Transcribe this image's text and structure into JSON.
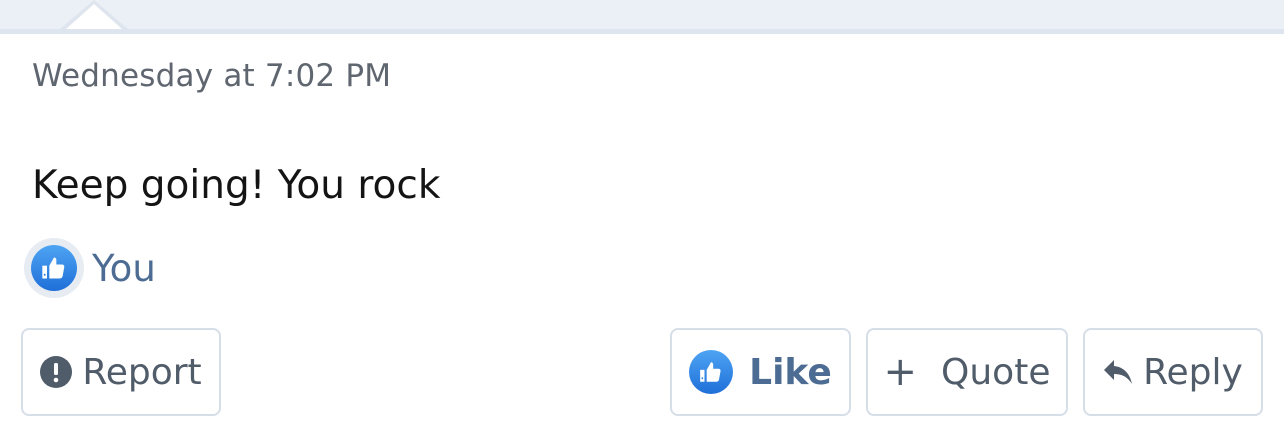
{
  "post": {
    "timestamp": "Wednesday at 7:02 PM",
    "message": "Keep going! You rock"
  },
  "reactions": {
    "icon": "thumbs-up-icon",
    "user": "You"
  },
  "actions": {
    "report_label": "Report",
    "like_label": "Like",
    "quote_label": "Quote",
    "reply_label": "Reply"
  },
  "colors": {
    "accent": "#4d6c93",
    "like_blue": "#2a7fe0",
    "text": "#141414",
    "muted": "#5f6670",
    "border": "#d6dee8"
  }
}
